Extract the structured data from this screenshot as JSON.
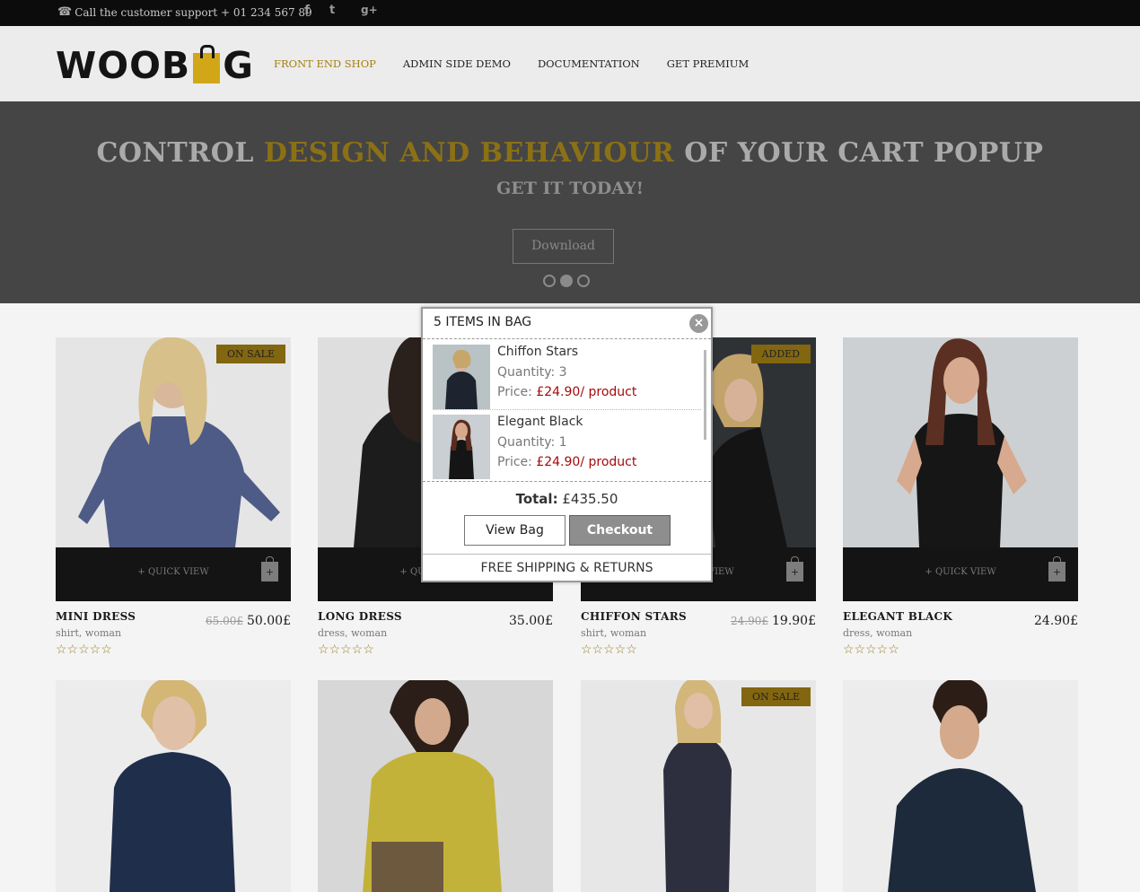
{
  "topbar": {
    "support": "Call the customer support + 01 234 567 89",
    "social": [
      "facebook-icon",
      "twitter-icon",
      "google-plus-icon"
    ]
  },
  "header": {
    "logo_left": "WOOB",
    "logo_right": "G",
    "nav": [
      "FRONT END SHOP",
      "ADMIN SIDE DEMO",
      "DOCUMENTATION",
      "GET PREMIUM"
    ],
    "active_nav": "FRONT END SHOP"
  },
  "hero": {
    "title_pre": "CONTROL ",
    "title_highlight": "DESIGN AND BEHAVIOUR",
    "title_post": " OF YOUR CART POPUP",
    "subtitle": "GET IT TODAY!",
    "button": "Download",
    "slides": 3,
    "active_slide": 2
  },
  "products": [
    {
      "name": "MINI DRESS",
      "tags": "shirt, woman",
      "old_price": "65.00£",
      "price": "50.00£",
      "badge": "ON SALE",
      "quick_view": "+ QUICK VIEW",
      "rating": 0
    },
    {
      "name": "LONG DRESS",
      "tags": "dress, woman",
      "old_price": "",
      "price": "35.00£",
      "badge": "",
      "quick_view": "+ QUICK VIEW",
      "rating": 0
    },
    {
      "name": "CHIFFON STARS",
      "tags": "shirt, woman",
      "old_price": "24.90£",
      "price": "19.90£",
      "badge": "ADDED",
      "quick_view": "+ QUICK VIEW",
      "rating": 0
    },
    {
      "name": "ELEGANT BLACK",
      "tags": "dress, woman",
      "old_price": "",
      "price": "24.90£",
      "badge": "",
      "quick_view": "+ QUICK VIEW",
      "rating": 0
    }
  ],
  "products_row2": [
    {
      "badge": ""
    },
    {
      "badge": ""
    },
    {
      "badge": "ON SALE"
    },
    {
      "badge": ""
    }
  ],
  "popup": {
    "title": "5 ITEMS IN BAG",
    "items": [
      {
        "name": "Chiffon Stars",
        "quantity": "Quantity: 3",
        "price_label": "Price: ",
        "price": "£24.90/ product"
      },
      {
        "name": "Elegant Black",
        "quantity": "Quantity: 1",
        "price_label": "Price: ",
        "price": "£24.90/ product"
      }
    ],
    "total_label": "Total:",
    "total": "£435.50",
    "view_bag": "View Bag",
    "checkout": "Checkout",
    "shipping": "FREE SHIPPING & RETURNS"
  },
  "colors": {
    "accent": "#c9a10f",
    "price_red": "#a50a0a",
    "topbar": "#0c0c0c"
  }
}
